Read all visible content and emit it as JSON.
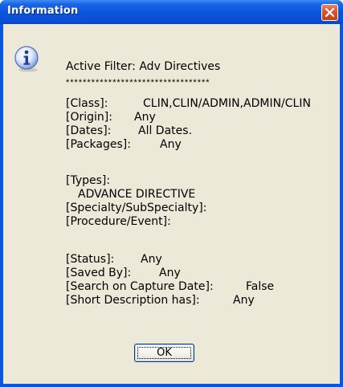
{
  "dialog": {
    "title": "Information",
    "icon": "information-icon",
    "header": "Active Filter: Adv Directives",
    "separator": "**********************************",
    "lines": {
      "class_label": "[Class]:",
      "class_value": "CLIN,CLIN/ADMIN,ADMIN/CLIN",
      "origin_label": "[Origin]:",
      "origin_value": "Any",
      "dates_label": "[Dates]:",
      "dates_value": "All Dates.",
      "packages_label": "[Packages]:",
      "packages_value": "Any",
      "types_label": "[Types]:",
      "types_value": "ADVANCE DIRECTIVE",
      "specialty_label": "[Specialty/SubSpecialty]:",
      "procedure_label": "[Procedure/Event]:",
      "status_label": "[Status]:",
      "status_value": "Any",
      "saved_by_label": "[Saved By]:",
      "saved_by_value": "Any",
      "search_capture_label": "[Search on Capture Date]:",
      "search_capture_value": "False",
      "short_desc_label": "[Short Description has]:",
      "short_desc_value": "Any"
    },
    "ok_label": "OK",
    "close_icon": "close-icon"
  },
  "colors": {
    "titlebar": "#0a55dc",
    "client_bg": "#ece9d8",
    "close_button": "#d9532f"
  }
}
